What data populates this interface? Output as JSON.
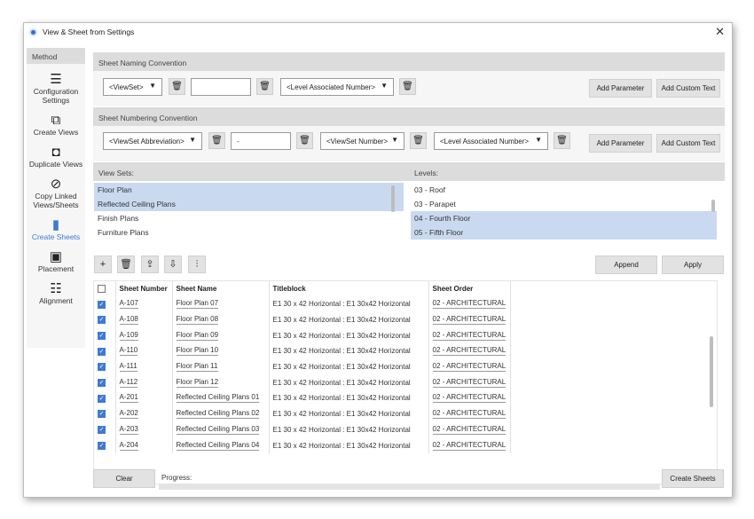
{
  "window": {
    "title": "View & Sheet from Settings",
    "close": "✕"
  },
  "sidebar": {
    "header": "Method",
    "items": [
      {
        "label": "Configuration Settings",
        "icon": "sliders-icon",
        "glyph": "☰"
      },
      {
        "label": "Create Views",
        "icon": "copy-icon",
        "glyph": "⧉"
      },
      {
        "label": "Duplicate Views",
        "icon": "duplicate-icon",
        "glyph": "⧉"
      },
      {
        "label": "Copy Linked Views/Sheets",
        "icon": "link-copy-icon",
        "glyph": "⧉"
      },
      {
        "label": "Create Sheets",
        "icon": "sheets-icon",
        "glyph": "▮"
      },
      {
        "label": "Placement",
        "icon": "placement-icon",
        "glyph": "▣"
      },
      {
        "label": "Alignment",
        "icon": "alignment-icon",
        "glyph": "☷"
      }
    ]
  },
  "naming": {
    "header": "Sheet Naming Convention",
    "dd1": "<ViewSet>",
    "text1": "",
    "dd2": "<Level Associated Number>",
    "add_param": "Add Parameter",
    "add_custom": "Add Custom Text"
  },
  "numbering": {
    "header": "Sheet Numbering Convention",
    "dd1": "<ViewSet Abbreviation>",
    "text1": "-",
    "dd2": "<ViewSet Number>",
    "dd3": "<Level Associated Number>",
    "add_param": "Add Parameter",
    "add_custom": "Add Custom Text"
  },
  "view_sets": {
    "header": "View Sets:",
    "items": [
      {
        "label": "Floor Plan",
        "selected": true
      },
      {
        "label": "Reflected Ceiling Plans",
        "selected": true
      },
      {
        "label": "Finish Plans",
        "selected": false
      },
      {
        "label": "Furniture Plans",
        "selected": false
      }
    ]
  },
  "levels": {
    "header": "Levels:",
    "items": [
      {
        "label": "03 - Roof",
        "selected": false
      },
      {
        "label": "03 - Parapet",
        "selected": false
      },
      {
        "label": "04 - Fourth Floor",
        "selected": true
      },
      {
        "label": "05 - Fifth Floor",
        "selected": true
      }
    ]
  },
  "toolbar": {
    "add": "+",
    "delete": "🗑",
    "export": "⇪",
    "import": "⇩",
    "settings": "⫶",
    "append": "Append",
    "apply": "Apply"
  },
  "table": {
    "headers": [
      "",
      "Sheet Number",
      "Sheet Name",
      "Titleblock",
      "Sheet Order"
    ],
    "rows": [
      [
        "A-107",
        "Floor Plan 07",
        "E1 30 x 42 Horizontal : E1 30x42 Horizontal",
        "02 - ARCHITECTURAL"
      ],
      [
        "A-108",
        "Floor Plan 08",
        "E1 30 x 42 Horizontal : E1 30x42 Horizontal",
        "02 - ARCHITECTURAL"
      ],
      [
        "A-109",
        "Floor Plan 09",
        "E1 30 x 42 Horizontal : E1 30x42 Horizontal",
        "02 - ARCHITECTURAL"
      ],
      [
        "A-110",
        "Floor Plan 10",
        "E1 30 x 42 Horizontal : E1 30x42 Horizontal",
        "02 - ARCHITECTURAL"
      ],
      [
        "A-111",
        "Floor Plan 11",
        "E1 30 x 42 Horizontal : E1 30x42 Horizontal",
        "02 - ARCHITECTURAL"
      ],
      [
        "A-112",
        "Floor Plan 12",
        "E1 30 x 42 Horizontal : E1 30x42 Horizontal",
        "02 - ARCHITECTURAL"
      ],
      [
        "A-201",
        "Reflected Ceiling Plans 01",
        "E1 30 x 42 Horizontal : E1 30x42 Horizontal",
        "02 - ARCHITECTURAL"
      ],
      [
        "A-202",
        "Reflected Ceiling Plans 02",
        "E1 30 x 42 Horizontal : E1 30x42 Horizontal",
        "02 - ARCHITECTURAL"
      ],
      [
        "A-203",
        "Reflected Ceiling Plans 03",
        "E1 30 x 42 Horizontal : E1 30x42 Horizontal",
        "02 - ARCHITECTURAL"
      ],
      [
        "A-204",
        "Reflected Ceiling Plans 04",
        "E1 30 x 42 Horizontal : E1 30x42 Horizontal",
        "02 - ARCHITECTURAL"
      ]
    ]
  },
  "footer": {
    "clear": "Clear",
    "progress_label": "Progress:",
    "create_sheets": "Create Sheets"
  },
  "colors": {
    "accent": "#3e7bd0",
    "selection": "#c9daf0",
    "header_bg": "#dcdcdc"
  }
}
